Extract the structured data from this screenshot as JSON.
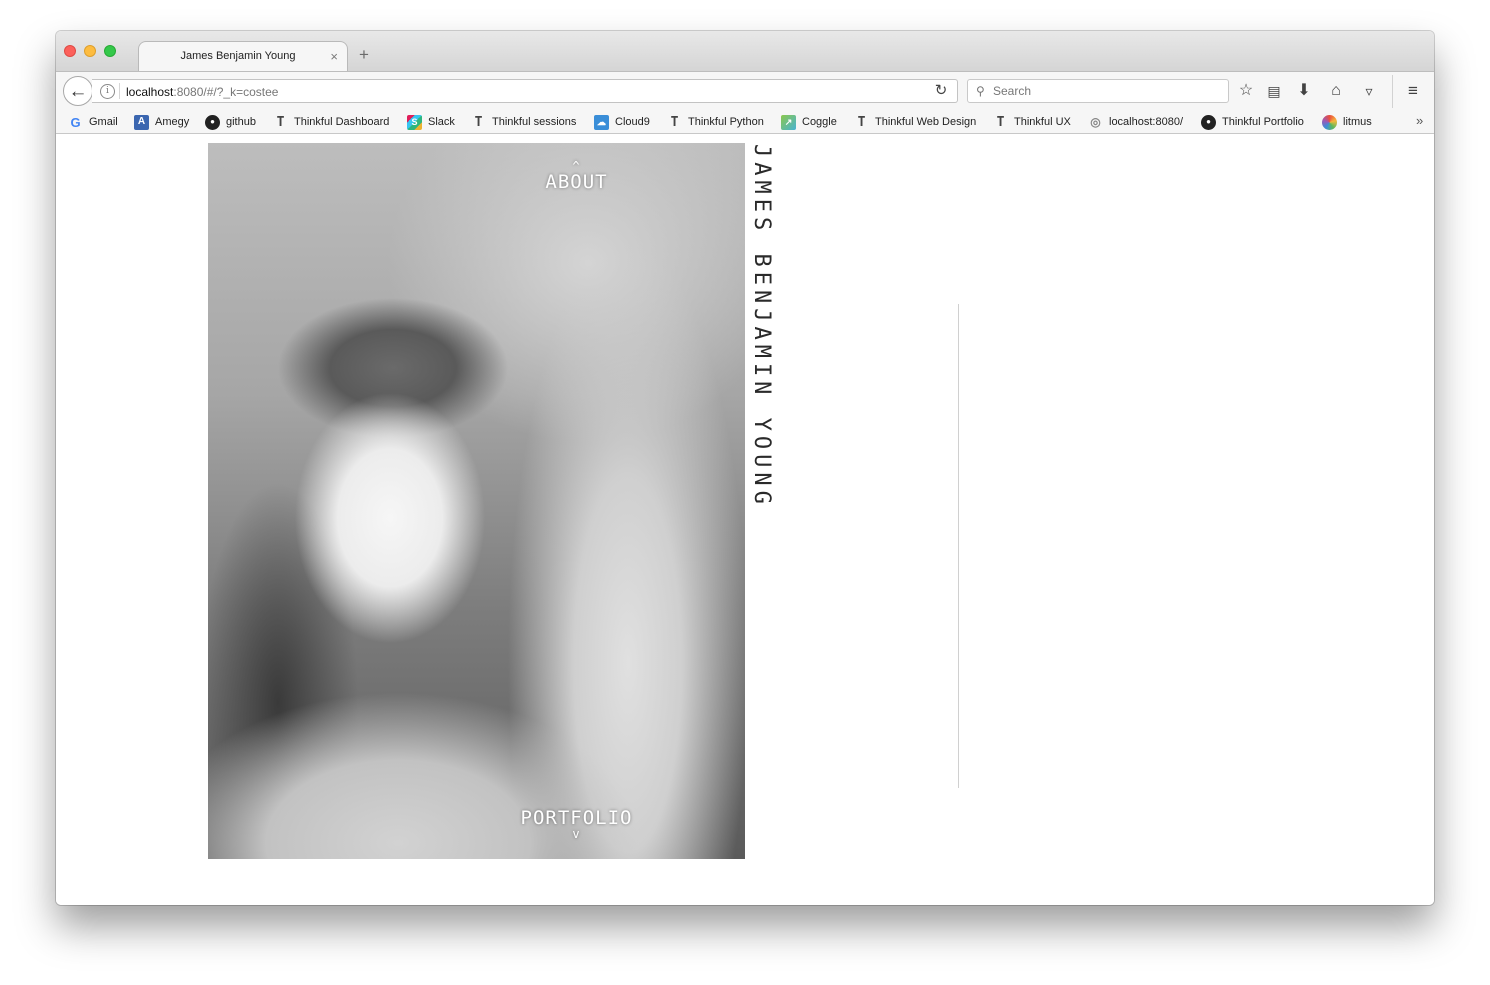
{
  "browser": {
    "tab_title": "James Benjamin Young",
    "tab_close": "×",
    "new_tab": "+",
    "url_host": "localhost",
    "url_rest": ":8080/#/?_k=costee",
    "search_placeholder": "Search"
  },
  "icons": {
    "back": "arrow-left-icon",
    "info": "info-icon",
    "reload": "reload-icon",
    "search": "magnifier-icon",
    "bookmark_star": "star-icon",
    "reading_list": "clipboard-icon",
    "downloads": "download-icon",
    "home": "home-icon",
    "pocket": "pocket-icon",
    "menu": "hamburger-icon"
  },
  "bookmarks": [
    {
      "label": "Gmail",
      "icon": "google-icon"
    },
    {
      "label": "Amegy",
      "icon": "amegy-icon"
    },
    {
      "label": "github",
      "icon": "github-icon"
    },
    {
      "label": "Thinkful Dashboard",
      "icon": "thinkful-icon"
    },
    {
      "label": "Slack",
      "icon": "slack-icon"
    },
    {
      "label": "Thinkful sessions",
      "icon": "thinkful-icon"
    },
    {
      "label": "Cloud9",
      "icon": "cloud9-icon"
    },
    {
      "label": "Thinkful Python",
      "icon": "thinkful-icon"
    },
    {
      "label": "Coggle",
      "icon": "coggle-icon"
    },
    {
      "label": "Thinkful Web Design",
      "icon": "thinkful-icon"
    },
    {
      "label": "Thinkful UX",
      "icon": "thinkful-icon"
    },
    {
      "label": "localhost:8080/",
      "icon": "globe-icon"
    },
    {
      "label": "Thinkful Portfolio",
      "icon": "github-icon"
    },
    {
      "label": "litmus",
      "icon": "litmus-icon"
    }
  ],
  "page": {
    "about_caret": "^",
    "about_label": "ABOUT",
    "portfolio_label": "PORTFOLIO",
    "portfolio_caret": "v",
    "name": "JAMES BENJAMIN YOUNG"
  },
  "colors": {
    "close": "#fc605b",
    "minimize": "#fdbc40",
    "maximize": "#34c84a"
  }
}
